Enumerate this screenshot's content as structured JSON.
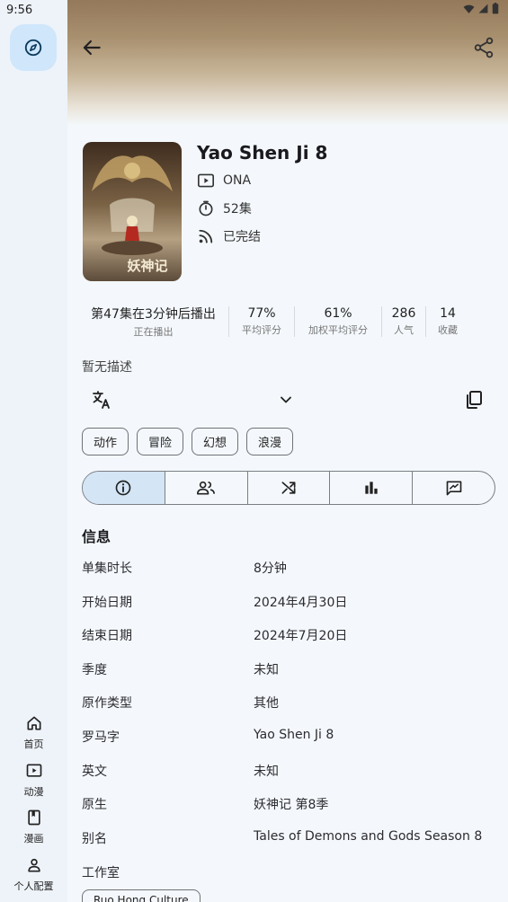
{
  "status_bar": {
    "time": "9:56"
  },
  "rail": {
    "nav": [
      {
        "label": "首页"
      },
      {
        "label": "动漫"
      },
      {
        "label": "漫画"
      },
      {
        "label": "个人配置"
      }
    ]
  },
  "detail": {
    "title": "Yao Shen Ji 8",
    "type": "ONA",
    "episodes": "52集",
    "status": "已完结",
    "poster_text": "妖神记",
    "stats": [
      {
        "value": "第47集在3分钟后播出",
        "label": "正在播出"
      },
      {
        "value": "77%",
        "label": "平均评分"
      },
      {
        "value": "61%",
        "label": "加权平均评分"
      },
      {
        "value": "286",
        "label": "人气"
      },
      {
        "value": "14",
        "label": "收藏"
      }
    ],
    "description": "暂无描述",
    "tags": [
      "动作",
      "冒险",
      "幻想",
      "浪漫"
    ],
    "tabs": [
      "info-icon",
      "characters-icon",
      "relations-icon",
      "stats-icon",
      "reviews-icon"
    ],
    "info_title": "信息",
    "info": [
      {
        "key": "单集时长",
        "value": "8分钟"
      },
      {
        "key": "开始日期",
        "value": "2024年4月30日"
      },
      {
        "key": "结束日期",
        "value": "2024年7月20日"
      },
      {
        "key": "季度",
        "value": "未知"
      },
      {
        "key": "原作类型",
        "value": "其他"
      },
      {
        "key": "罗马字",
        "value": "Yao Shen Ji 8"
      },
      {
        "key": "英文",
        "value": "未知"
      },
      {
        "key": "原生",
        "value": "妖神记 第8季"
      },
      {
        "key": "别名",
        "value": "Tales of Demons and Gods Season 8"
      },
      {
        "key": "工作室",
        "value": ""
      }
    ],
    "studio": "Ruo Hong Culture"
  },
  "colors": {
    "accent": "#cfe6fb",
    "tab_selected": "#d4e5f5",
    "background": "#f4f8fc"
  }
}
